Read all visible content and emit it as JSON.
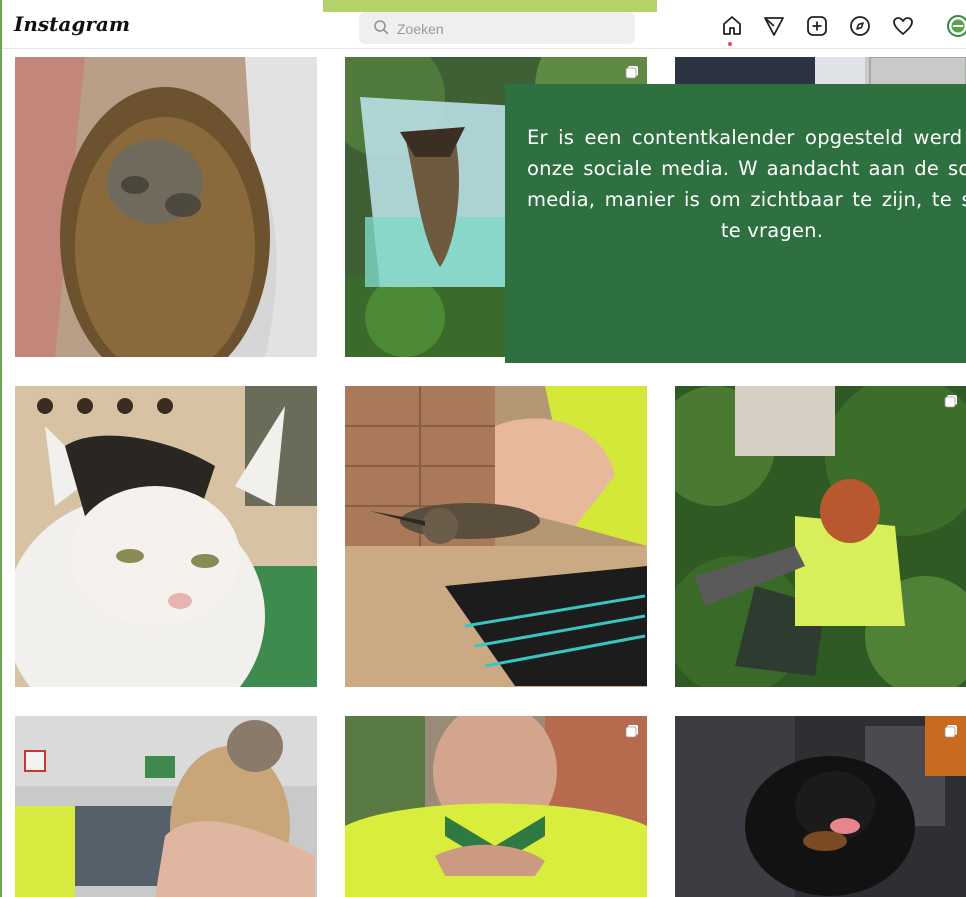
{
  "header": {
    "logo": "Instagram",
    "search_placeholder": "Zoeken",
    "nav_icons": [
      "home-icon",
      "direct-send-icon",
      "new-post-icon",
      "explore-icon",
      "activity-heart-icon",
      "profile-avatar"
    ]
  },
  "overlay": {
    "text": "Er is een contentkalender opgesteld werd voor onze sociale media. W aandacht aan de sociale media, manier is om zichtbaar te zijn, te steun te vragen."
  },
  "posts": [
    {
      "subject": "hedgehog",
      "multi": false
    },
    {
      "subject": "bat-in-container",
      "multi": true
    },
    {
      "subject": "person-in-suit",
      "multi": false
    },
    {
      "subject": "kitten",
      "multi": false
    },
    {
      "subject": "sandpiper-bird",
      "multi": false
    },
    {
      "subject": "volunteer-in-ivy",
      "multi": true
    },
    {
      "subject": "sparrowhawk",
      "multi": false
    },
    {
      "subject": "man-in-hi-vis",
      "multi": true
    },
    {
      "subject": "rottweiler-in-car",
      "multi": true
    }
  ],
  "colors": {
    "overlay_bg": "#2e7040",
    "top_accent": "#b5d36b",
    "notification_dot": "#ed4956"
  }
}
